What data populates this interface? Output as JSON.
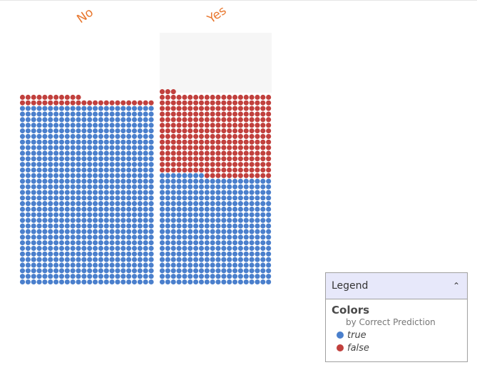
{
  "chart_data": {
    "type": "waffle",
    "facets": [
      {
        "label": "No",
        "counts": {
          "true": 768,
          "false": 35
        }
      },
      {
        "label": "Yes",
        "counts": {
          "true": 388,
          "false": 295
        }
      }
    ],
    "series": [
      {
        "name": "true",
        "color": "#4a7fcc"
      },
      {
        "name": "false",
        "color": "#c1403d"
      }
    ]
  },
  "legend": {
    "title": "Legend",
    "toggle_icon": "chevron-up-icon",
    "section_title": "Colors",
    "section_subtitle": "by Correct Prediction",
    "items": [
      {
        "label": "true",
        "color": "#4a7fcc"
      },
      {
        "label": "false",
        "color": "#c1403d"
      }
    ]
  }
}
